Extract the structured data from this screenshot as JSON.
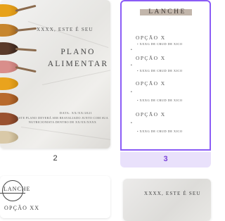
{
  "pages": [
    {
      "number": "2",
      "sub_header": "XXXX, ESTE É SEU",
      "title_line1": "PLANO",
      "title_line2": "ALIMENTAR",
      "date_line": "DATA: XX/XX/2021",
      "note_line1": "ESTE PLANO DEVERÁ SER REAVALIADO JUNTO COM SUA",
      "note_line2": "NUTRICIONISTA DENTRO DE XX/XX/XXXX"
    },
    {
      "number": "3",
      "selected": true,
      "header": "LANCHE",
      "header_sub": "-",
      "options": [
        {
          "label": "OPÇÃO X",
          "line1": "• XXXG DE CRUD DE XICO",
          "line2": "•"
        },
        {
          "label": "OPÇÃO X",
          "line1": "•",
          "line2": "• XXXG DE CRUD DE XICO"
        },
        {
          "label": "OPÇÃO X",
          "line1": "•",
          "line2": "• XXXG DE CRUD DE XICO"
        },
        {
          "label": "OPÇÃO X",
          "line1": "•",
          "line2": "• XXXG DE CRUD DE XICO"
        }
      ]
    },
    {
      "header": "LANCHE",
      "option": "OPÇÃO XX"
    },
    {
      "sub_header": "XXXX, ESTE É SEU"
    }
  ],
  "colors": {
    "accent": "#8b5cf6",
    "selected_strip": "#e9e1fb",
    "selected_number": "#7a43d8",
    "header_bar": "#c2b6ab"
  }
}
